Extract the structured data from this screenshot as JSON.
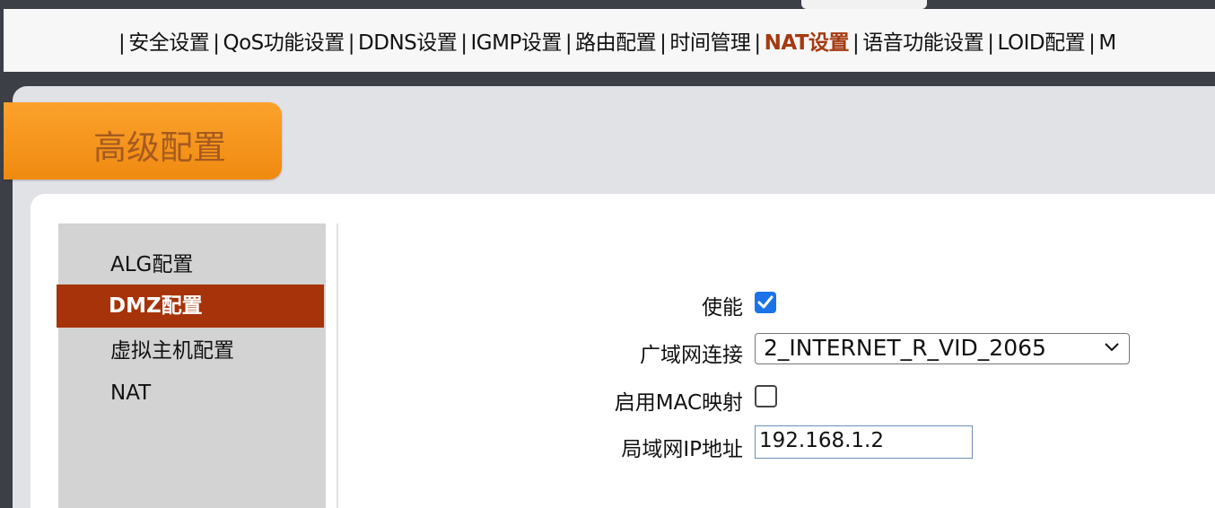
{
  "menu": {
    "leading_sep": "|",
    "items": [
      {
        "label": "安全设置"
      },
      {
        "label": "QoS功能设置"
      },
      {
        "label": "DDNS设置"
      },
      {
        "label": "IGMP设置"
      },
      {
        "label": "路由配置"
      },
      {
        "label": "时间管理"
      },
      {
        "label": "NAT设置",
        "active": true
      },
      {
        "label": "语音功能设置"
      },
      {
        "label": "LOID配置"
      },
      {
        "label": "M"
      }
    ]
  },
  "section": {
    "title": "高级配置"
  },
  "sidenav": {
    "items": [
      {
        "label": "ALG配置"
      },
      {
        "label": "DMZ配置",
        "active": true
      },
      {
        "label": "虚拟主机配置"
      },
      {
        "label": "NAT"
      }
    ]
  },
  "form": {
    "enable_label": "使能",
    "enable_checked": true,
    "wan_label": "广域网连接",
    "wan_value": "2_INTERNET_R_VID_2065",
    "mac_label": "启用MAC映射",
    "mac_checked": false,
    "lan_ip_label": "局域网IP地址",
    "lan_ip_value": "192.168.1.2"
  },
  "colors": {
    "accent": "#a63309",
    "tab_orange": "#f7941d",
    "checkbox_blue": "#1a73e8"
  }
}
